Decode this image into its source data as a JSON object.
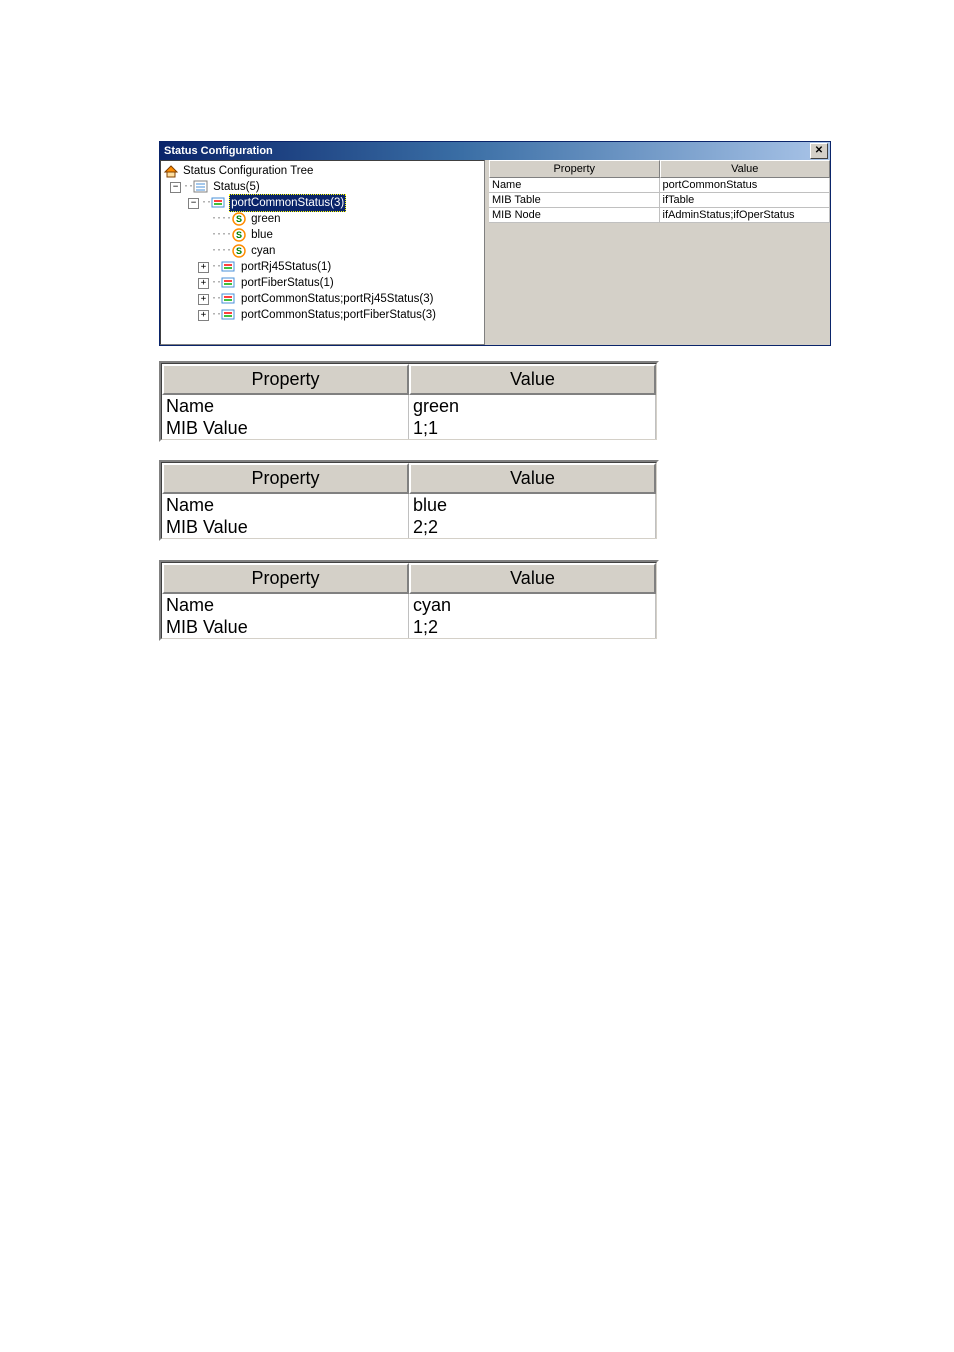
{
  "window": {
    "title": "Status Configuration",
    "close_glyph": "✕"
  },
  "tree": {
    "root": "Status Configuration Tree",
    "status": "Status(5)",
    "portCommonStatus": "portCommonStatus(3)",
    "green": "green",
    "blue": "blue",
    "cyan": "cyan",
    "portRj45Status": "portRj45Status(1)",
    "portFiberStatus": "portFiberStatus(1)",
    "pcsRj45": "portCommonStatus;portRj45Status(3)",
    "pcsFiber": "portCommonStatus;portFiberStatus(3)"
  },
  "mainGrid": {
    "headers": {
      "property": "Property",
      "value": "Value"
    },
    "rows": [
      {
        "property": "Name",
        "value": "portCommonStatus"
      },
      {
        "property": "MIB Table",
        "value": "ifTable"
      },
      {
        "property": "MIB Node",
        "value": "ifAdminStatus;ifOperStatus"
      }
    ]
  },
  "smallTablesCommon": {
    "propertyHeader": "Property",
    "valueHeader": "Value",
    "propName": "Name",
    "propMibValue": "MIB Value"
  },
  "smallTables": [
    {
      "name": "green",
      "mib": "1;1"
    },
    {
      "name": "blue",
      "mib": "2;2"
    },
    {
      "name": "cyan",
      "mib": "1;2"
    }
  ]
}
